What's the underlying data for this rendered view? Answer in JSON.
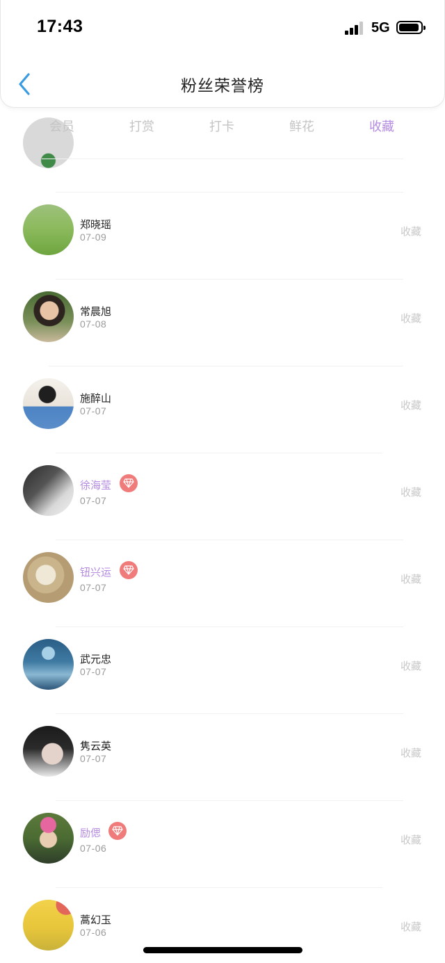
{
  "status_bar": {
    "time": "17:43",
    "network": "5G"
  },
  "nav": {
    "title": "粉丝荣誉榜",
    "back_icon": "chevron-left-icon",
    "accent": "#3a9be0"
  },
  "tabs": [
    {
      "label": "会员",
      "active": false
    },
    {
      "label": "打赏",
      "active": false
    },
    {
      "label": "打卡",
      "active": false
    },
    {
      "label": "鲜花",
      "active": false
    },
    {
      "label": "收藏",
      "active": true
    }
  ],
  "colors": {
    "active_tab": "#b48be0",
    "vip_name": "#b48be0",
    "vip_badge": "#f07b7b",
    "action_text": "#c8c8c8"
  },
  "list": [
    {
      "name": "郑晓瑶",
      "date": "07-09",
      "vip": false,
      "action": "收藏"
    },
    {
      "name": "常晨旭",
      "date": "07-08",
      "vip": false,
      "action": "收藏"
    },
    {
      "name": "施醉山",
      "date": "07-07",
      "vip": false,
      "action": "收藏"
    },
    {
      "name": "徐海莹",
      "date": "07-07",
      "vip": true,
      "action": "收藏"
    },
    {
      "name": "钮兴运",
      "date": "07-07",
      "vip": true,
      "action": "收藏"
    },
    {
      "name": "武元忠",
      "date": "07-07",
      "vip": false,
      "action": "收藏"
    },
    {
      "name": "隽云英",
      "date": "07-07",
      "vip": false,
      "action": "收藏"
    },
    {
      "name": "励偲",
      "date": "07-06",
      "vip": true,
      "action": "收藏"
    },
    {
      "name": "蒿幻玉",
      "date": "07-06",
      "vip": false,
      "action": "收藏"
    }
  ]
}
